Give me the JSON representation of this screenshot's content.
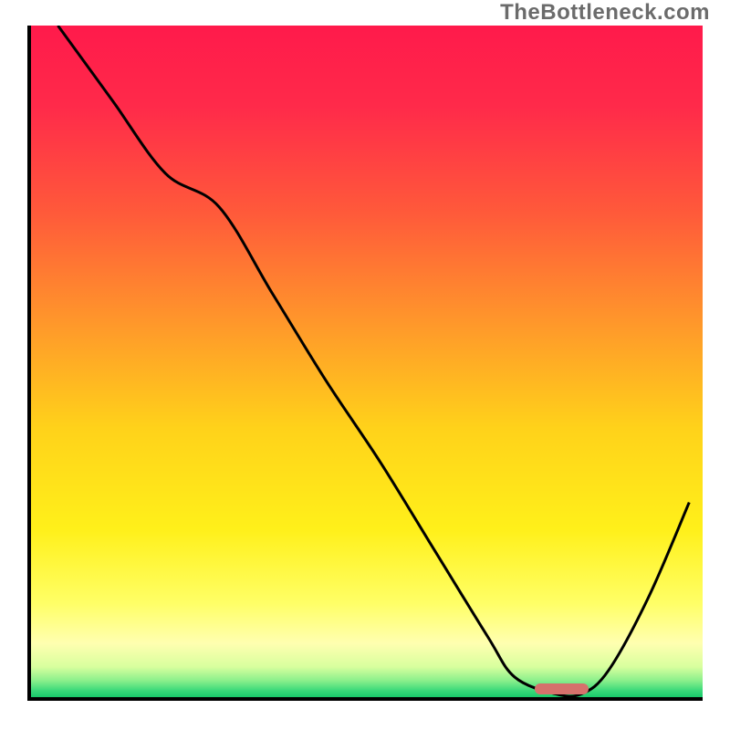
{
  "watermark": "TheBottleneck.com",
  "chart_data": {
    "type": "line",
    "title": "",
    "xlabel": "",
    "ylabel": "",
    "xlim": [
      0,
      100
    ],
    "ylim": [
      0,
      100
    ],
    "x": [
      4,
      12,
      20,
      28,
      36,
      44,
      52,
      60,
      68,
      72,
      78,
      82,
      86,
      92,
      98
    ],
    "values": [
      100,
      89,
      78,
      73,
      60,
      47,
      35,
      22,
      9,
      3,
      0.5,
      0.5,
      4,
      15,
      29
    ],
    "marker": {
      "x_center": 79,
      "x_halfwidth": 4,
      "y": 1.2
    },
    "gradient_stops": [
      {
        "offset": 0.0,
        "color": "#ff1a4b"
      },
      {
        "offset": 0.12,
        "color": "#ff2a4a"
      },
      {
        "offset": 0.28,
        "color": "#ff5a3a"
      },
      {
        "offset": 0.45,
        "color": "#ff9a2a"
      },
      {
        "offset": 0.6,
        "color": "#ffd21a"
      },
      {
        "offset": 0.75,
        "color": "#fff01a"
      },
      {
        "offset": 0.86,
        "color": "#ffff66"
      },
      {
        "offset": 0.92,
        "color": "#ffffb0"
      },
      {
        "offset": 0.955,
        "color": "#d8ff9e"
      },
      {
        "offset": 0.975,
        "color": "#8cf08c"
      },
      {
        "offset": 0.99,
        "color": "#3bd97a"
      },
      {
        "offset": 1.0,
        "color": "#18c96a"
      }
    ],
    "marker_color": "#d6716c",
    "curve_color": "#000000",
    "curve_width": 3
  }
}
